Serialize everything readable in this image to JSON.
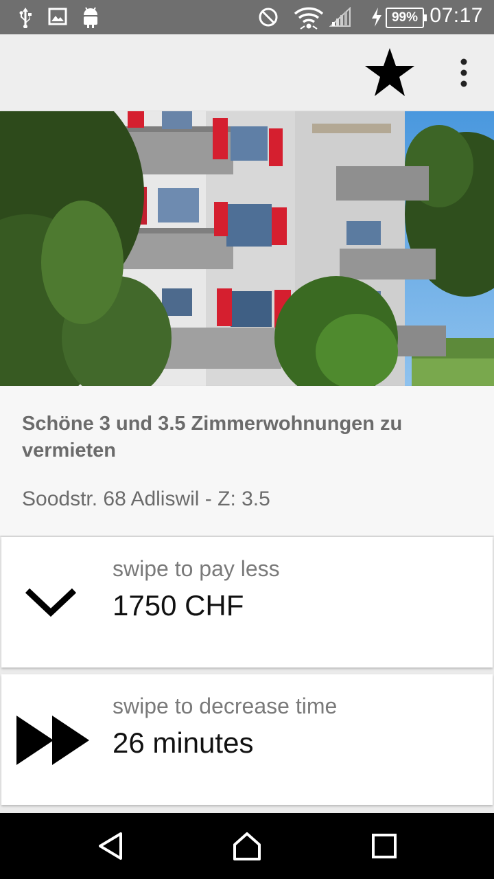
{
  "status_bar": {
    "time": "07:17",
    "battery": "99%",
    "icons": [
      "usb-icon",
      "image-icon",
      "android-icon",
      "do-not-disturb-icon",
      "wifi-icon",
      "signal-icon",
      "charging-icon"
    ]
  },
  "app_bar": {
    "favorite_icon": "star-icon",
    "menu_icon": "overflow-menu-icon"
  },
  "listing": {
    "title": "Schöne 3 und 3.5 Zimmerwohnungen zu vermieten",
    "address": "Soodstr. 68 Adliswil - Z: 3.5"
  },
  "price_card": {
    "hint": "swipe to pay less",
    "value": "1750 CHF",
    "icon": "chevron-down-icon"
  },
  "time_card": {
    "hint": "swipe to decrease time",
    "value": "26 minutes",
    "icon": "fast-forward-icon"
  },
  "nav_bar": {
    "icons": [
      "back-icon",
      "home-icon",
      "recents-icon"
    ]
  },
  "colors": {
    "status_bar": "#6f6f6f",
    "app_bar": "#eeeeee",
    "card_text_muted": "#7a7a7a",
    "nav_bar": "#000000"
  }
}
